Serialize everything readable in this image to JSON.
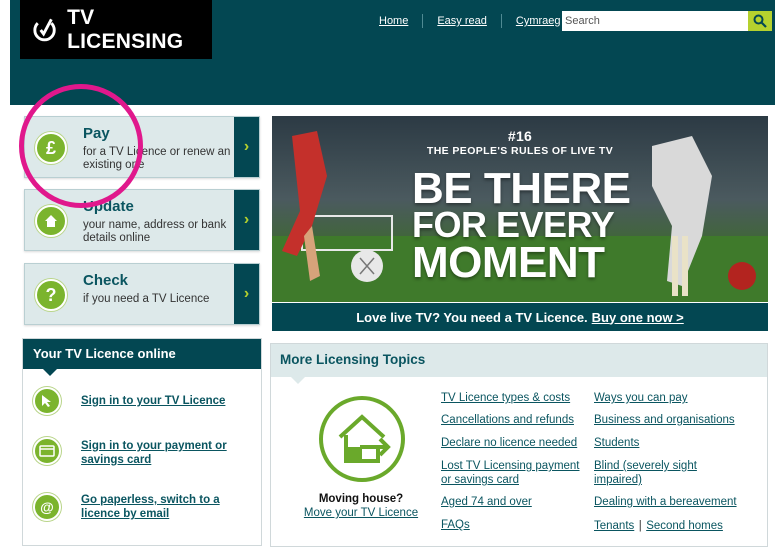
{
  "brand": {
    "name": "TV LICENSING",
    "color_primary": "#034752",
    "color_accent": "#b5d12e",
    "color_green": "#7bb42d"
  },
  "topnav": {
    "items": [
      "Home",
      "Easy read",
      "Cymraeg"
    ]
  },
  "search": {
    "placeholder": "Search",
    "icon": "search-icon"
  },
  "actions": [
    {
      "title": "Pay",
      "description": "for a TV Licence or renew an existing one",
      "icon": "pound-icon"
    },
    {
      "title": "Update",
      "description": "your name, address or bank details online",
      "icon": "house-icon"
    },
    {
      "title": "Check",
      "description": "if you need a TV Licence",
      "icon": "question-icon"
    }
  ],
  "hero": {
    "number": "#16",
    "subtitle": "THE PEOPLE'S RULES OF LIVE TV",
    "line1": "BE THERE",
    "line2": "FOR EVERY",
    "line3": "MOMENT",
    "bar_text": "Love live TV? You need a TV Licence.",
    "bar_link": "Buy one now >"
  },
  "online": {
    "heading": "Your TV Licence online",
    "items": [
      {
        "label": "Sign in to your TV Licence",
        "icon": "cursor-icon"
      },
      {
        "label": "Sign in to your payment or savings card",
        "icon": "card-icon"
      },
      {
        "label": "Go paperless, switch to a licence by email",
        "icon": "at-icon"
      }
    ]
  },
  "topics": {
    "heading": "More Licensing Topics",
    "move_question": "Moving house?",
    "move_link": "Move your TV Licence",
    "col1": [
      "TV Licence types & costs",
      "Cancellations and refunds",
      "Declare no licence needed",
      "Lost TV Licensing payment or savings card",
      "Aged 74 and over",
      "FAQs"
    ],
    "col2": [
      "Ways you can pay",
      "Business and organisations",
      "Students",
      "Blind (severely sight impaired)",
      "Dealing with a bereavement"
    ],
    "col2_last": [
      "Tenants",
      "Second homes"
    ],
    "col2_sep": "|"
  }
}
